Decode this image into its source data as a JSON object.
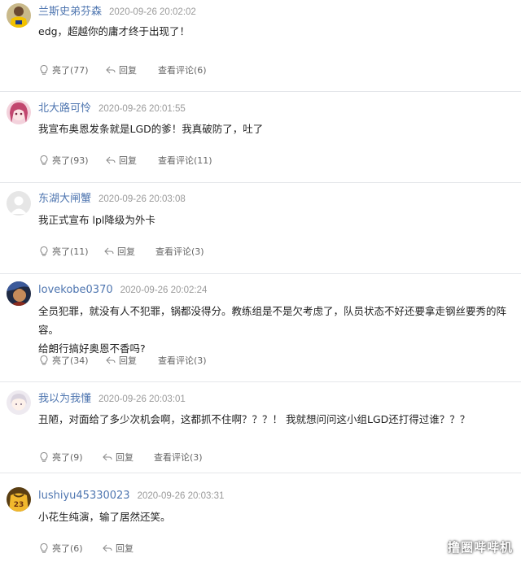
{
  "comments": [
    {
      "username": "兰斯史弟芬森",
      "timestamp": "2020-09-26 20:02:02",
      "text": "edg，超越你的庸才终于出现了！",
      "like_label": "亮了(77)",
      "reply_label": "回复",
      "view_label": "查看评论(6)",
      "avatar": "avatar-yellow-jersey"
    },
    {
      "username": "北大路可怜",
      "timestamp": "2020-09-26 20:01:55",
      "text": "我宣布奥恩发条就是LGD的爹！我真破防了，吐了",
      "like_label": "亮了(93)",
      "reply_label": "回复",
      "view_label": "查看评论(11)",
      "avatar": "avatar-anime-girl-pink"
    },
    {
      "username": "东湖大闸蟹",
      "timestamp": "2020-09-26 20:03:08",
      "text": "我正式宣布 lpl降级为外卡",
      "like_label": "亮了(11)",
      "reply_label": "回复",
      "view_label": "查看评论(3)",
      "avatar": "avatar-default-gray"
    },
    {
      "username": "lovekobe0370",
      "timestamp": "2020-09-26 20:02:24",
      "text": "全员犯罪，就没有人不犯罪，锅都没得分。教练组是不是欠考虑了，队员状态不好还要拿走钢丝要秀的阵容。\n给朗行搞好奥恩不香吗?",
      "like_label": "亮了(34)",
      "reply_label": "回复",
      "view_label": "查看评论(3)",
      "avatar": "avatar-dark-character"
    },
    {
      "username": "我以为我懂",
      "timestamp": "2020-09-26 20:03:01",
      "text": "丑陋，对面给了多少次机会啊，这都抓不住啊？？？！ 我就想问问这小组LGD还打得过谁？？？",
      "like_label": "亮了(9)",
      "reply_label": "回复",
      "view_label": "查看评论(3)",
      "avatar": "avatar-light-anime"
    },
    {
      "username": "lushiyu45330023",
      "timestamp": "2020-09-26 20:03:31",
      "text": "小花生纯演，输了居然还笑。",
      "like_label": "亮了(6)",
      "reply_label": "回复",
      "view_label": "",
      "avatar": "avatar-gold-jersey-23"
    }
  ],
  "icons": {
    "like": "lightbulb-icon",
    "reply": "reply-arrow-icon"
  },
  "colors": {
    "username": "#4f76b0",
    "timestamp": "#9a9a9a",
    "divider": "#e4e6ea",
    "action_text": "#666666"
  },
  "watermark": "撸圈哔哔机"
}
